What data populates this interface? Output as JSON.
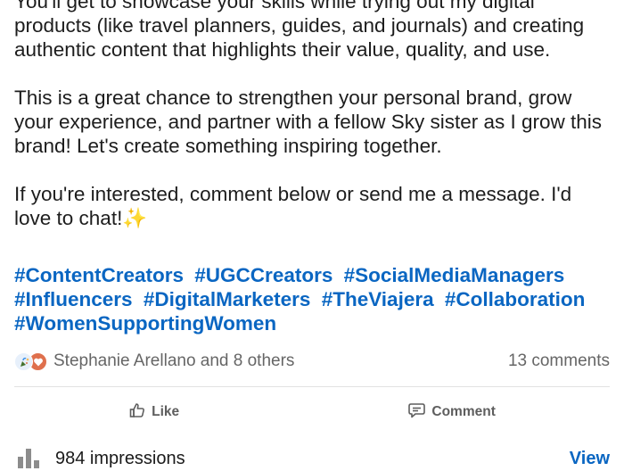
{
  "post": {
    "paragraphs": [
      "You'll get to showcase your skills while trying out my digital products (like travel planners, guides, and journals) and creating authentic content that highlights their value, quality, and use.",
      "This is a great chance to strengthen your personal brand, grow your experience, and partner with a fellow Sky sister as I grow this brand! Let's create something inspiring together.",
      "If you're interested, comment below or send me a message. I'd love to chat!"
    ],
    "emoji": "✨",
    "hashtags": [
      "#ContentCreators",
      "#UGCCreators",
      "#SocialMediaManagers",
      "#Influencers",
      "#DigitalMarketers",
      "#TheViajera",
      "#Collaboration",
      "#WomenSupportingWomen"
    ]
  },
  "social": {
    "reactions_text": "Stephanie Arellano and 8 others",
    "comments_text": "13 comments",
    "reaction_icons": [
      "celebrate-icon",
      "love-icon"
    ]
  },
  "actions": {
    "like_label": "Like",
    "comment_label": "Comment"
  },
  "footer": {
    "impressions_text": "984 impressions",
    "view_label": "View"
  },
  "colors": {
    "link": "#0a66c2",
    "muted": "#666666",
    "love": "#df704d"
  }
}
